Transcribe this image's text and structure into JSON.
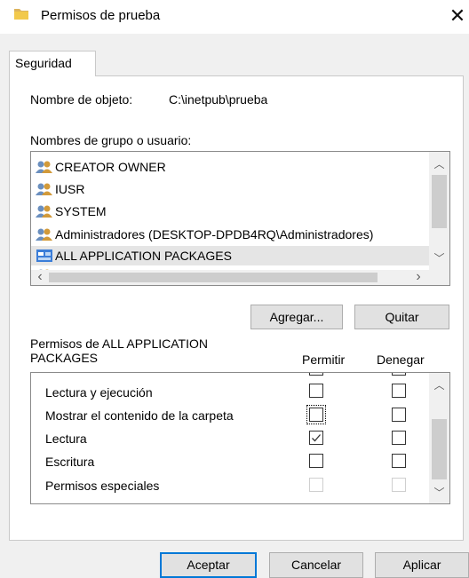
{
  "window": {
    "title": "Permisos de prueba",
    "close_glyph": "✕",
    "folder_icon": "folder-icon",
    "folder_color": "#dcb35c"
  },
  "tabs": [
    {
      "label": "Seguridad",
      "selected": true
    }
  ],
  "object": {
    "label": "Nombre de objeto:",
    "value": "C:\\inetpub\\prueba"
  },
  "users": {
    "label": "Nombres de grupo o usuario:",
    "items": [
      {
        "name": "CREATOR OWNER",
        "icon": "user-group-icon",
        "selected": false
      },
      {
        "name": "IUSR",
        "icon": "user-group-icon",
        "selected": false
      },
      {
        "name": "SYSTEM",
        "icon": "user-group-icon",
        "selected": false
      },
      {
        "name": "Administradores (DESKTOP-DPDB4RQ\\Administradores)",
        "icon": "user-group-icon",
        "selected": false
      },
      {
        "name": "ALL APPLICATION PACKAGES",
        "icon": "app-packages-icon",
        "selected": true
      }
    ],
    "add_button": "Agregar...",
    "remove_button": "Quitar"
  },
  "permissions": {
    "label_line1": "Permisos de ALL APPLICATION",
    "label_line2": "PACKAGES",
    "allow_header": "Permitir",
    "deny_header": "Denegar",
    "items": [
      {
        "name": "Lectura y ejecución",
        "allow": false,
        "deny": false,
        "disabled": false
      },
      {
        "name": "Mostrar el contenido de la carpeta",
        "allow": false,
        "deny": false,
        "disabled": false
      },
      {
        "name": "Lectura",
        "allow": true,
        "deny": false,
        "disabled": false
      },
      {
        "name": "Escritura",
        "allow": false,
        "deny": false,
        "disabled": false
      },
      {
        "name": "Permisos especiales",
        "allow": false,
        "deny": false,
        "disabled": true
      }
    ]
  },
  "footer": {
    "ok": "Aceptar",
    "cancel": "Cancelar",
    "apply": "Aplicar"
  },
  "colors": {
    "accent": "#0078d7",
    "dialog_bg": "#f0f0f0",
    "selected_row": "#e5e5e5"
  }
}
